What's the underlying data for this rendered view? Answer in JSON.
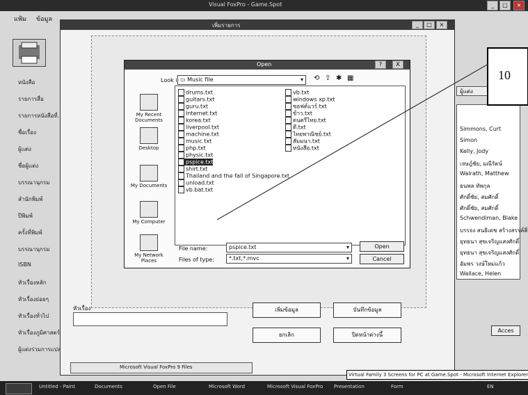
{
  "outer": {
    "title": "Visual FoxPro - Game.Spot",
    "menu": [
      "แฟ้ม",
      "ข้อมูล"
    ],
    "controls": [
      "_",
      "□",
      "×"
    ]
  },
  "sidebar": {
    "items": [
      "หนังสือ",
      "รายการสื่อ",
      "รายการหนังสือที่...",
      "ชื่อเรื่อง",
      "ผู้แต่ง",
      "ชื่อผู้แต่ง",
      "บรรณานุกรม",
      "สำนักพิมพ์",
      "ปีพิมพ์",
      "ครั้งที่พิมพ์",
      "บรรณานุกรม",
      "ISBN",
      "หัวเรื่องหลัก",
      "หัวเรื่องย่อยๆ",
      "หัวเรื่องทั่วไป",
      "หัวเรื่องภูมิศาสตร์",
      "ผู้แต่งร่วมการแปล"
    ]
  },
  "inner": {
    "title": "เพิ่มรายการ",
    "controls": [
      "_",
      "□",
      "×"
    ],
    "label_field": "หัวเรื่อง",
    "buttons": {
      "add": "เพิ่มข้อมูล",
      "save": "บันทึกข้อมูล",
      "cancel": "ยกเลิก",
      "close": "ปิดหน้าต่างนี้"
    },
    "nav_label": "Microsoft Visual FoxPro 9 Files"
  },
  "dialog": {
    "title": "Open",
    "look_in_label": "Look in:",
    "look_in_value": "Music file",
    "places": [
      "My Recent Documents",
      "Desktop",
      "My Documents",
      "My Computer",
      "My Network Places"
    ],
    "files_col1": [
      "drums.txt",
      "guitars.txt",
      "guru.txt",
      "Internet.txt",
      "korea.txt",
      "liverpool.txt",
      "machine.txt",
      "music.txt",
      "php.txt",
      "physic.txt",
      "pspice.txt",
      "shirt.txt",
      "Thailand and the fall of Singapore.txt",
      "unload.txt",
      "vb.bat.txt"
    ],
    "files_col2": [
      "vb.txt",
      "windows xp.txt",
      "ซอฟต์แวร์.txt",
      "ข้าว.txt",
      "ดนตรีไทย.txt",
      "ดี.txt",
      "ไทยพาณิชย์.txt",
      "สัมมนา.txt",
      "หนังสือ.txt"
    ],
    "selected_file": "pspice.txt",
    "file_name_label": "File name:",
    "file_name_value": "pspice.txt",
    "file_type_label": "Files of type:",
    "file_type_value": "*.txt,*.mvc",
    "open_button": "Open",
    "cancel_button": "Cancel",
    "controls": [
      "?",
      "X"
    ]
  },
  "right_panel": {
    "header": "ผู้แต่ง",
    "items": [
      "Simmons, Curt",
      "Simon",
      "Kelly, Jody",
      "เจษฎ์ชัย, มณีรัตน์",
      "Walrath, Matthew",
      "ธนพล ทัพกุล",
      "ศักดิ์ชัย, สมศักดิ์",
      "ศักดิ์ชัย, สมศักดิ์",
      "Schwendiman, Blake",
      "บรรจง สนธิเดช สร้างสรรค์สิ่ง",
      "ยุทธนา สุขเจริญแสงศักดิ์",
      "ยุทธนา สุขเจริญแสงศักดิ์",
      "อัมพร วงษ์ใหม่แก้ว",
      "Wallace, Helen"
    ],
    "button": "Acces"
  },
  "callout": {
    "number": "10"
  },
  "taskbar": {
    "tasks": [
      "Untitled - Paint",
      "Documents",
      "Open File",
      "Microsoft Word",
      "Microsoft Visual FoxPro",
      "Presentation",
      "Form"
    ],
    "tooltip": "Virtual Family 3 Screens for PC at Game.Spot - Microsoft Internet Explorer",
    "tray": "EN"
  }
}
